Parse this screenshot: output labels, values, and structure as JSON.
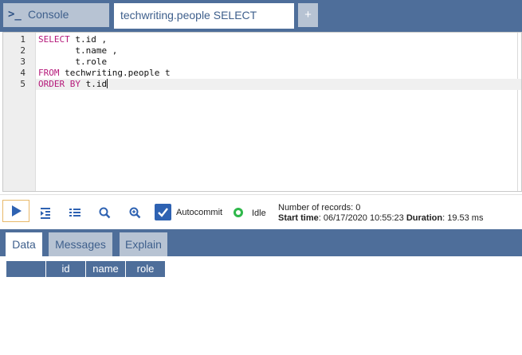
{
  "tabs": {
    "console_label": "Console",
    "active_label": "techwriting.people SELECT",
    "add_label": "+"
  },
  "editor": {
    "line_numbers": [
      "1",
      "2",
      "3",
      "4",
      "5"
    ],
    "lines": [
      [
        {
          "text": "SELECT",
          "kw": true
        },
        {
          "text": " t.id ,",
          "kw": false
        }
      ],
      [
        {
          "text": "       t.name ,",
          "kw": false
        }
      ],
      [
        {
          "text": "       t.role",
          "kw": false
        }
      ],
      [
        {
          "text": "FROM",
          "kw": true
        },
        {
          "text": " techwriting.people t",
          "kw": false
        }
      ],
      [
        {
          "text": "ORDER BY",
          "kw": true
        },
        {
          "text": " t.id",
          "kw": false
        }
      ]
    ],
    "active_line": 5
  },
  "toolbar": {
    "autocommit_label": "Autocommit",
    "autocommit_checked": true,
    "status_label": "Idle",
    "records_label": "Number of records: 0",
    "start_label": "Start time",
    "start_value": ": 06/17/2020 10:55:23",
    "duration_label": "Duration",
    "duration_value": ": 19.53 ms"
  },
  "result_tabs": [
    {
      "label": "Data",
      "active": true
    },
    {
      "label": "Messages",
      "active": false
    },
    {
      "label": "Explain",
      "active": false
    }
  ],
  "grid": {
    "columns": [
      "",
      "id",
      "name",
      "role"
    ]
  },
  "colors": {
    "header_blue": "#4e6e9a",
    "inactive_tab": "#b7c3d3",
    "keyword": "#b5197a",
    "run_blue": "#2e62b2",
    "idle_green": "#2fb84a"
  }
}
